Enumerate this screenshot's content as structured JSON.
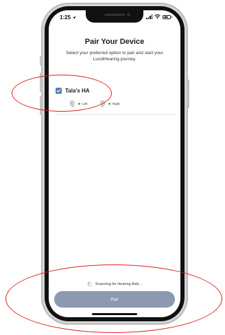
{
  "status_bar": {
    "time": "1:25"
  },
  "page": {
    "title": "Pair Your Device",
    "subtitle": "Select your preferred option to pair and start your LucidHearing journey."
  },
  "device": {
    "name": "Tala's HA",
    "checked": true,
    "left_label": "Left",
    "right_label": "Right"
  },
  "scanning": {
    "text": "Scanning for Hearing Aids..."
  },
  "pair_button": {
    "label": "Pair"
  },
  "colors": {
    "checkbox": "#5a7ea8",
    "pair_button": "#8b9ab1",
    "annotation": "#e31e24",
    "status_dot": "#3cb44b"
  }
}
